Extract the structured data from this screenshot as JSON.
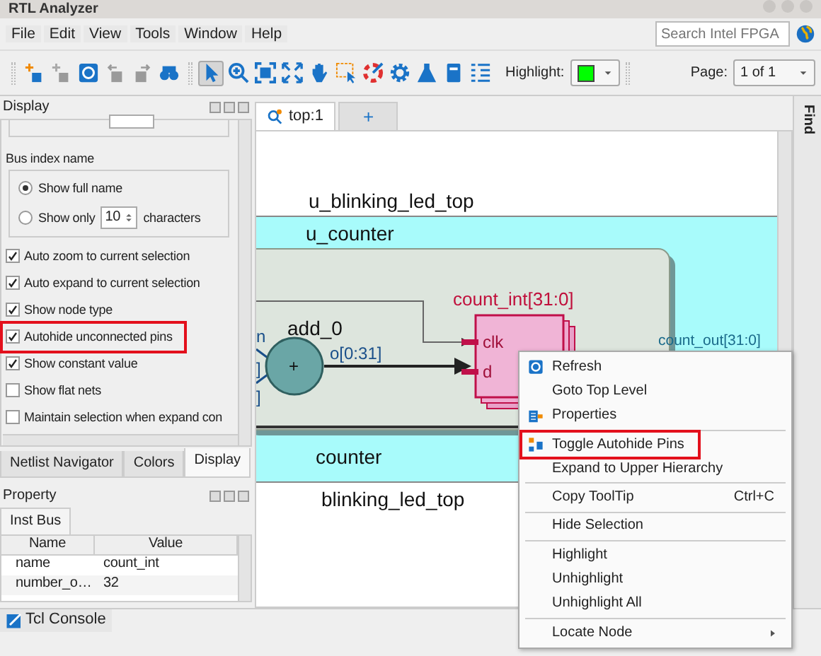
{
  "window": {
    "title": "RTL Analyzer"
  },
  "menu": [
    "File",
    "Edit",
    "View",
    "Tools",
    "Window",
    "Help"
  ],
  "search": {
    "placeholder": "Search Intel FPGA"
  },
  "toolbar": {
    "tools": [
      {
        "kind": "add",
        "disabled": false,
        "selected": false
      },
      {
        "kind": "add",
        "disabled": true,
        "selected": false
      },
      {
        "kind": "refresh",
        "disabled": false,
        "selected": false
      },
      {
        "kind": "back",
        "disabled": true,
        "selected": false
      },
      {
        "kind": "forward",
        "disabled": true,
        "selected": false
      },
      {
        "kind": "binoculars",
        "disabled": false,
        "selected": false
      },
      {
        "kind": "pointer",
        "disabled": false,
        "selected": true
      },
      {
        "kind": "zoom",
        "disabled": false,
        "selected": false
      },
      {
        "kind": "fit",
        "disabled": false,
        "selected": false
      },
      {
        "kind": "expand",
        "disabled": false,
        "selected": false
      },
      {
        "kind": "hand",
        "disabled": false,
        "selected": false
      },
      {
        "kind": "select",
        "disabled": false,
        "selected": false
      },
      {
        "kind": "palette",
        "disabled": false,
        "selected": false
      },
      {
        "kind": "gear",
        "disabled": false,
        "selected": false
      },
      {
        "kind": "flask",
        "disabled": false,
        "selected": false
      },
      {
        "kind": "document",
        "disabled": false,
        "selected": false
      },
      {
        "kind": "list",
        "disabled": false,
        "selected": false
      }
    ],
    "highlight": {
      "label": "Highlight:",
      "color": "#00ff00"
    },
    "page": {
      "label": "Page:",
      "value": "1 of 1"
    }
  },
  "display_panel": {
    "title": "Display",
    "bus_index": {
      "title": "Bus index name",
      "options": [
        {
          "label": "Show full name",
          "selected": true
        },
        {
          "label": "Show only",
          "selected": false,
          "value": "10",
          "suffix": "characters"
        }
      ]
    },
    "options": [
      {
        "label": "Auto zoom to current selection",
        "checked": true,
        "highlighted": false
      },
      {
        "label": "Auto expand to current selection",
        "checked": true,
        "highlighted": false
      },
      {
        "label": "Show node type",
        "checked": true,
        "highlighted": false
      },
      {
        "label": "Autohide unconnected pins",
        "checked": true,
        "highlighted": true
      },
      {
        "label": "Show constant value",
        "checked": true,
        "highlighted": false
      },
      {
        "label": "Show flat nets",
        "checked": false,
        "highlighted": false
      },
      {
        "label": "Maintain selection when expand con",
        "checked": false,
        "highlighted": false
      }
    ]
  },
  "left_tabs": [
    {
      "label": "Netlist Navigator",
      "selected": false
    },
    {
      "label": "Colors",
      "selected": false
    },
    {
      "label": "Display",
      "selected": true
    }
  ],
  "property_panel": {
    "title": "Property",
    "tabs": [
      {
        "label": "Inst Bus",
        "selected": true
      }
    ],
    "columns": [
      "Name",
      "Value"
    ],
    "rows": [
      [
        "name",
        "count_int"
      ],
      [
        "number_o…",
        "32"
      ]
    ]
  },
  "view_tabs": [
    {
      "kind": "view",
      "label": "top:1",
      "selected": true
    },
    {
      "kind": "add",
      "label": "+",
      "selected": false
    }
  ],
  "diagram": {
    "top_instance": "u_blinking_led_top",
    "sub_instance": "u_counter",
    "cut_pins": [
      "n",
      "]",
      "]"
    ],
    "adder": "add_0",
    "adder_symbol": "+",
    "adder_output": "o[0:31]",
    "register": "count_int[31:0]",
    "register_pins": [
      "clk",
      "d"
    ],
    "output_port": "count_out[31:0]",
    "sub_type": "counter",
    "top_type": "blinking_led_top"
  },
  "context_menu": [
    {
      "kind": "item",
      "label": "Refresh",
      "highlighted": false
    },
    {
      "kind": "item",
      "label": "Goto Top Level",
      "highlighted": false
    },
    {
      "kind": "item",
      "label": "Properties",
      "highlighted": false
    },
    {
      "kind": "separator"
    },
    {
      "kind": "item",
      "label": "Toggle Autohide Pins",
      "highlighted": true
    },
    {
      "kind": "item",
      "label": "Expand to Upper Hierarchy",
      "highlighted": false
    },
    {
      "kind": "separator"
    },
    {
      "kind": "item",
      "label": "Copy ToolTip",
      "shortcut": "Ctrl+C",
      "highlighted": false
    },
    {
      "kind": "separator"
    },
    {
      "kind": "item",
      "label": "Hide Selection",
      "highlighted": false
    },
    {
      "kind": "separator"
    },
    {
      "kind": "item",
      "label": "Highlight",
      "highlighted": false
    },
    {
      "kind": "item",
      "label": "Unhighlight",
      "highlighted": false
    },
    {
      "kind": "item",
      "label": "Unhighlight All",
      "highlighted": false
    },
    {
      "kind": "separator"
    },
    {
      "kind": "submenu",
      "label": "Locate Node",
      "highlighted": false
    }
  ],
  "find_panel": {
    "title": "Find"
  },
  "console_tab": {
    "label": "Tcl Console"
  }
}
